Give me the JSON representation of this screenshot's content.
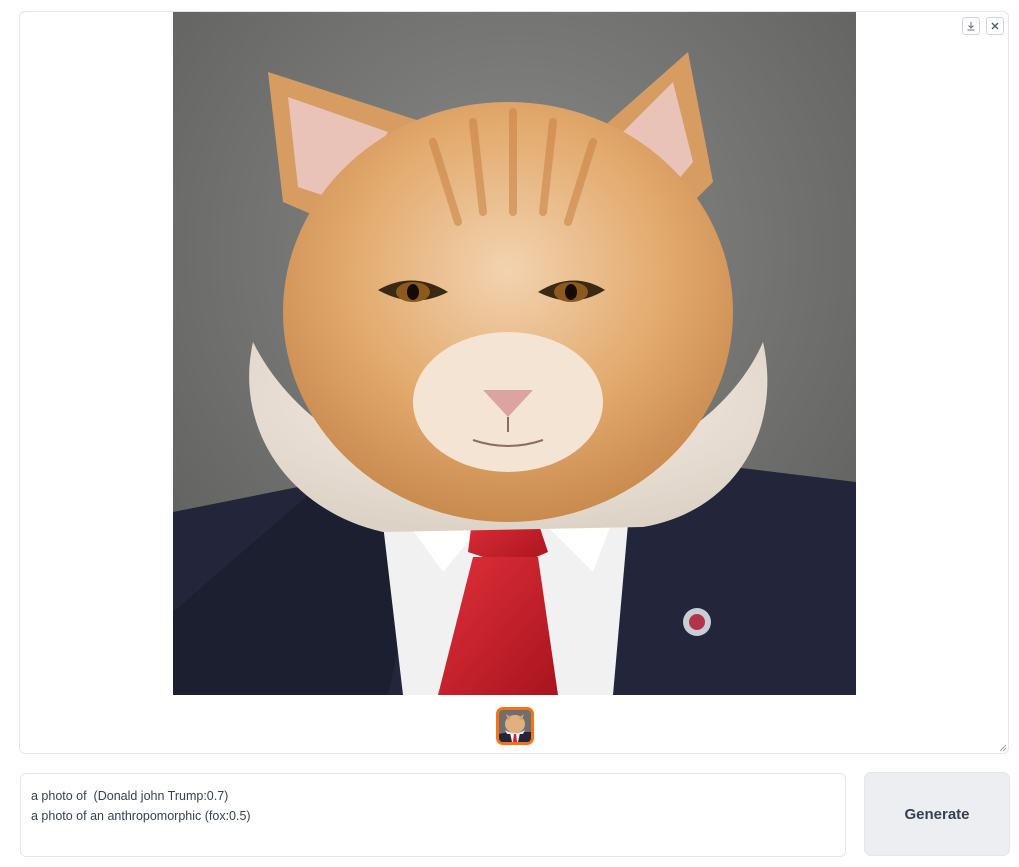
{
  "gallery": {
    "main_image": {
      "alt": "orange cat head on a person in a dark suit with white shirt and red tie",
      "icon": "cat-in-suit-image"
    },
    "buttons": {
      "download_icon": "download-icon",
      "close_icon": "close-icon"
    },
    "thumbnail": {
      "selected": true,
      "icon": "cat-in-suit-thumbnail"
    }
  },
  "prompt": {
    "value": "a photo of  (Donald john Trump:0.7)\na photo of an anthropomorphic (fox:0.5)"
  },
  "generate_button": {
    "label": "Generate"
  },
  "colors": {
    "accent": "#f97316",
    "button_bg": "#eceef2",
    "border": "#e5e7eb"
  }
}
